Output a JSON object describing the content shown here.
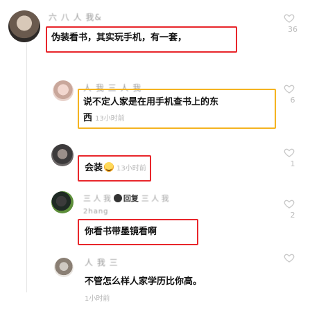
{
  "comments": [
    {
      "username": "六 八 人 我&",
      "text": "伪装看书，其实玩手机，有一套，",
      "time": "",
      "likes": "36"
    },
    {
      "username": "人 我 三 人 我",
      "text_line1": "说不定人家是在用手机查书上的东",
      "text_line2": "西",
      "time": "13小时前",
      "likes": "6"
    },
    {
      "username": "",
      "text": "会装",
      "emoji": "smile-emoji",
      "time": "13小时前",
      "likes": "1"
    },
    {
      "username": "三 人 我",
      "reply_to": "回复",
      "reply_user": "三 人 我",
      "handle": "2hang",
      "text": "你看书带墨镜看啊",
      "time": "",
      "likes": "2"
    },
    {
      "username": "人 我 三",
      "text": "不管怎么样人家学历比你高。",
      "time": "1小时前",
      "likes": ""
    }
  ],
  "colors": {
    "highlight_red": "#e8262b",
    "highlight_orange": "#f4b320",
    "time_gray": "#b5b5b5"
  }
}
